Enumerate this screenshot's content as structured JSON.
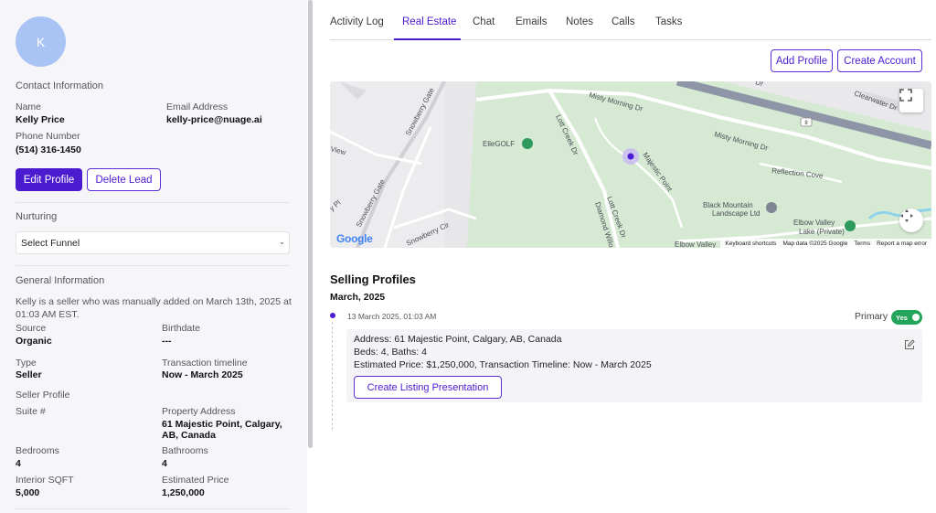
{
  "lead": {
    "avatar_initial": "K",
    "contact_title": "Contact Information",
    "name_label": "Name",
    "name": "Kelly Price",
    "email_label": "Email Address",
    "email": "kelly-price@nuage.ai",
    "phone_label": "Phone Number",
    "phone": "(514) 316-1450",
    "edit_profile": "Edit Profile",
    "delete_lead": "Delete Lead"
  },
  "nurturing": {
    "title": "Nurturing",
    "select_value": "Select Funnel"
  },
  "general": {
    "title": "General Information",
    "description": "Kelly is a seller who was manually added on March 13th, 2025 at 01:03 AM EST.",
    "source_label": "Source",
    "source": "Organic",
    "birthdate_label": "Birthdate",
    "birthdate": "---",
    "type_label": "Type",
    "type": "Seller",
    "timeline_label": "Transaction timeline",
    "timeline": "Now - March 2025"
  },
  "seller_profile": {
    "title": "Seller Profile",
    "suite_label": "Suite #",
    "suite": "",
    "address_label": "Property Address",
    "address": "61 Majestic Point, Calgary, AB, Canada",
    "bedrooms_label": "Bedrooms",
    "bedrooms": "4",
    "bathrooms_label": "Bathrooms",
    "bathrooms": "4",
    "sqft_label": "Interior SQFT",
    "sqft": "5,000",
    "price_label": "Estimated Price",
    "price": "1,250,000"
  },
  "tabs": [
    "Activity Log",
    "Real Estate",
    "Chat",
    "Emails",
    "Notes",
    "Calls",
    "Tasks"
  ],
  "active_tab": "Real Estate",
  "actions": {
    "add_profile": "Add Profile",
    "create_account": "Create Account"
  },
  "map": {
    "labels": {
      "misty_morning_1": "Misty Morning Dr",
      "misty_morning_2": "Misty Morning Dr",
      "lott_creek_1": "Lott Creek Dr",
      "lott_creek_2": "Lott Creek Dr",
      "snowberry_gate_1": "Snowberry Gate",
      "snowberry_gate_2": "Snowberry Gate",
      "snowberry_cir": "Snowberry Cir",
      "ellegolf": "ElleGOLF",
      "majestic_point": "Majestic Point",
      "reflection_cove": "Reflection Cove",
      "black_mountain_1": "Black Mountain",
      "black_mountain_2": "Landscape Ltd",
      "elbow_valley_lake_1": "Elbow Valley",
      "elbow_valley_lake_2": "Lake (Private)",
      "elbow_valley": "Elbow Valley",
      "diamond": "Diamond Willo",
      "clearwater": "Clearwater Dr",
      "view": "View",
      "pl": "y Pl",
      "route": "8",
      "dr_top": "Dr"
    },
    "google": "Google",
    "credits": {
      "shortcuts": "Keyboard shortcuts",
      "data": "Map data ©2025 Google",
      "terms": "Terms",
      "report": "Report a map error"
    }
  },
  "selling": {
    "title": "Selling Profiles",
    "month": "March, 2025",
    "timestamp": "13 March 2025, 01:03 AM",
    "primary_label": "Primary",
    "primary_toggle": "Yes",
    "address_line": "Address: 61 Majestic Point, Calgary, AB, Canada",
    "beds_line": "Beds: 4, Baths: 4",
    "price_line": "Estimated Price: $1,250,000, Transaction Timeline: Now - March 2025",
    "create_button": "Create Listing Presentation"
  },
  "colors": {
    "accent": "#4b1bd0",
    "avatar": "#a9c3f4",
    "toggle_on": "#23a55a"
  }
}
